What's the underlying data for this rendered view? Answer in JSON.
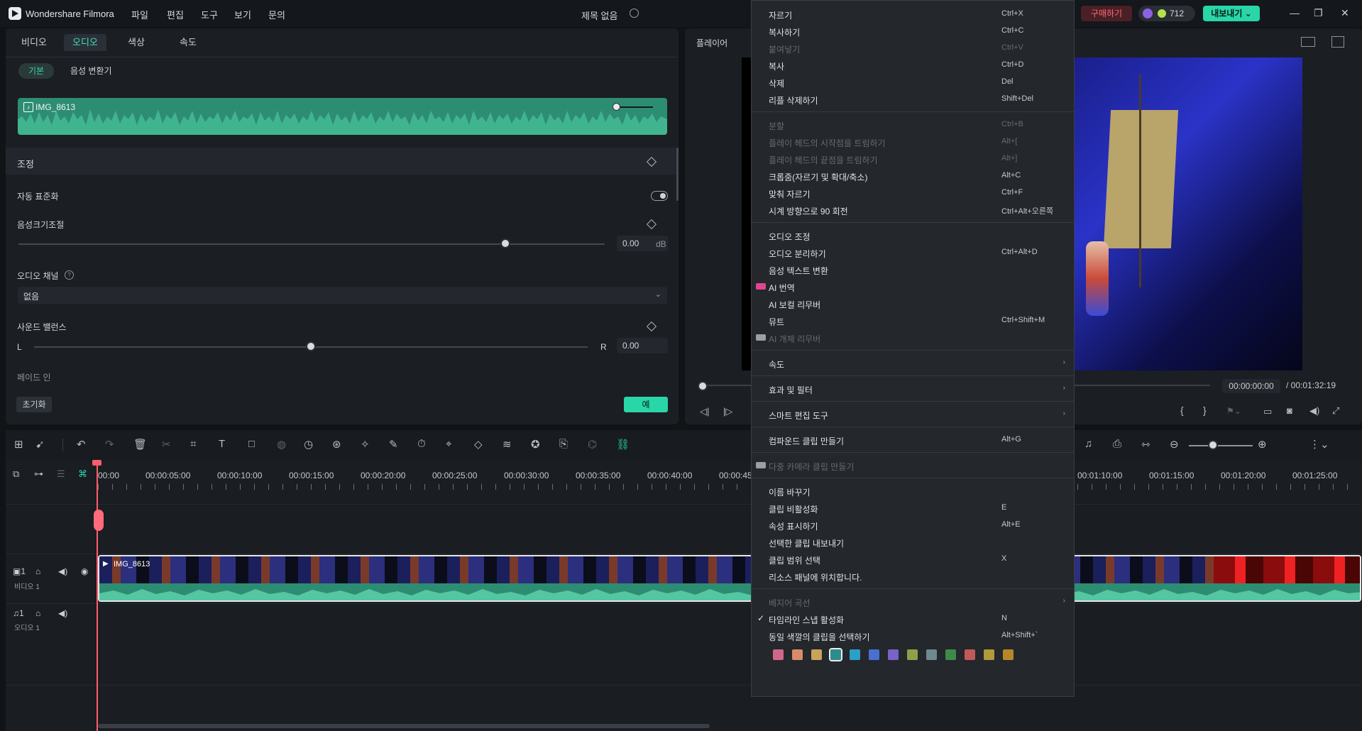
{
  "app": {
    "name": "Wondershare Filmora",
    "project_title": "제목 없음",
    "menus": [
      "파일",
      "편집",
      "도구",
      "보기",
      "문의"
    ],
    "buy_label": "구매하기",
    "credits": "712",
    "export_label": "내보내기"
  },
  "property_panel": {
    "tabs": [
      "비디오",
      "오디오",
      "색상",
      "속도"
    ],
    "active_tab": "오디오",
    "subtabs": [
      "기본",
      "음성 변환기"
    ],
    "clip_name": "IMG_8613",
    "section_title": "조정",
    "auto_normalize_label": "자동 표준화",
    "volume_label": "음성크기조절",
    "volume_value": "0.00",
    "volume_unit": "dB",
    "volume_level_fraction": 0.83,
    "channel_label": "오디오 채널",
    "channel_value": "없음",
    "balance_label": "사운드 밸런스",
    "balance_left": "L",
    "balance_right": "R",
    "balance_value": "0.00",
    "balance_level_fraction": 0.5,
    "fade_in_label": "페이드 인",
    "reset_label": "초기화",
    "ok_label": "예"
  },
  "player": {
    "tab_label": "플레이어",
    "time_current": "00:00:00:00",
    "time_total": "/ 00:01:32:19"
  },
  "timeline": {
    "ruler_left": [
      "00:00",
      "00:00:05:00",
      "00:00:10:00",
      "00:00:15:00",
      "00:00:20:00",
      "00:00:25:00",
      "00:00:30:00",
      "00:00:35:00",
      "00:00:40:00",
      "00:00:45"
    ],
    "ruler_right": [
      "00:01:10:00",
      "00:01:15:00",
      "00:01:20:00",
      "00:01:25:00"
    ],
    "video_track": {
      "number": "1",
      "name": "비디오 1",
      "clip_name": "IMG_8613"
    },
    "audio_track": {
      "number": "1",
      "name": "오디오 1"
    }
  },
  "context_menu": {
    "groups": [
      [
        {
          "label": "자르기",
          "shortcut": "Ctrl+X",
          "enabled": true
        },
        {
          "label": "복사하기",
          "shortcut": "Ctrl+C",
          "enabled": true
        },
        {
          "label": "붙여넣기",
          "shortcut": "Ctrl+V",
          "enabled": false
        },
        {
          "label": "복사",
          "shortcut": "Ctrl+D",
          "enabled": true
        },
        {
          "label": "삭제",
          "shortcut": "Del",
          "enabled": true
        },
        {
          "label": "리플 삭제하기",
          "shortcut": "Shift+Del",
          "enabled": true
        }
      ],
      [
        {
          "label": "분할",
          "shortcut": "Ctrl+B",
          "enabled": false
        },
        {
          "label": "플레이 헤드의 시작점을 트림하기",
          "shortcut": "Alt+[",
          "enabled": false
        },
        {
          "label": "플레이 헤드의 끝점을 트림하기",
          "shortcut": "Alt+]",
          "enabled": false
        },
        {
          "label": "크롭줌(자르기 및 확대/축소)",
          "shortcut": "Alt+C",
          "enabled": true
        },
        {
          "label": "맞춰 자르기",
          "shortcut": "Ctrl+F",
          "enabled": true
        },
        {
          "label": "시계 방향으로 90 회전",
          "shortcut": "Ctrl+Alt+오른쪽",
          "enabled": true
        }
      ],
      [
        {
          "label": "오디오 조정",
          "shortcut": "",
          "enabled": true
        },
        {
          "label": "오디오 분리하기",
          "shortcut": "Ctrl+Alt+D",
          "enabled": true
        },
        {
          "label": "음성 텍스트 변환",
          "shortcut": "",
          "enabled": true
        },
        {
          "label": "AI 번역",
          "shortcut": "",
          "enabled": true,
          "badge": "NEW"
        },
        {
          "label": "AI 보컬 리무버",
          "shortcut": "",
          "enabled": true
        },
        {
          "label": "뮤트",
          "shortcut": "Ctrl+Shift+M",
          "enabled": true
        },
        {
          "label": "AI 개체 리무버",
          "shortcut": "",
          "enabled": false,
          "badge": "AI"
        }
      ],
      [
        {
          "label": "속도",
          "shortcut": "",
          "enabled": true,
          "submenu": true
        }
      ],
      [
        {
          "label": "효과 및 필터",
          "shortcut": "",
          "enabled": true,
          "submenu": true
        }
      ],
      [
        {
          "label": "스마트 편집 도구",
          "shortcut": "",
          "enabled": true,
          "submenu": true
        }
      ],
      [
        {
          "label": "컴파운드 클립 만들기",
          "shortcut": "Alt+G",
          "enabled": true
        }
      ],
      [
        {
          "label": "다중 카메라 클립 만들기",
          "shortcut": "",
          "enabled": false,
          "badge": "AI"
        }
      ],
      [
        {
          "label": "이름 바꾸기",
          "shortcut": "",
          "enabled": true
        },
        {
          "label": "클립 비활성화",
          "shortcut": "E",
          "enabled": true
        },
        {
          "label": "속성 표시하기",
          "shortcut": "Alt+E",
          "enabled": true
        },
        {
          "label": "선택한 클립 내보내기",
          "shortcut": "",
          "enabled": true
        },
        {
          "label": "클립 범위 선택",
          "shortcut": "X",
          "enabled": true
        },
        {
          "label": "리소스 패널에 위치합니다.",
          "shortcut": "",
          "enabled": true
        }
      ],
      [
        {
          "label": "베지어 곡선",
          "shortcut": "",
          "enabled": false,
          "submenu": true
        },
        {
          "label": "타임라인 스냅 활성화",
          "shortcut": "N",
          "enabled": true,
          "checked": true
        },
        {
          "label": "동일 색깔의 클립을 선택하기",
          "shortcut": "Alt+Shift+`",
          "enabled": true
        }
      ]
    ],
    "color_swatches": [
      "#d0678a",
      "#d98a6a",
      "#c9a35a",
      "#2d8d8a",
      "#2aa0c8",
      "#4a6fd0",
      "#7a62c8",
      "#8fa04a",
      "#6f8a8f",
      "#3f8a4a",
      "#c05a5a",
      "#b09a3a",
      "#b8862a"
    ]
  }
}
